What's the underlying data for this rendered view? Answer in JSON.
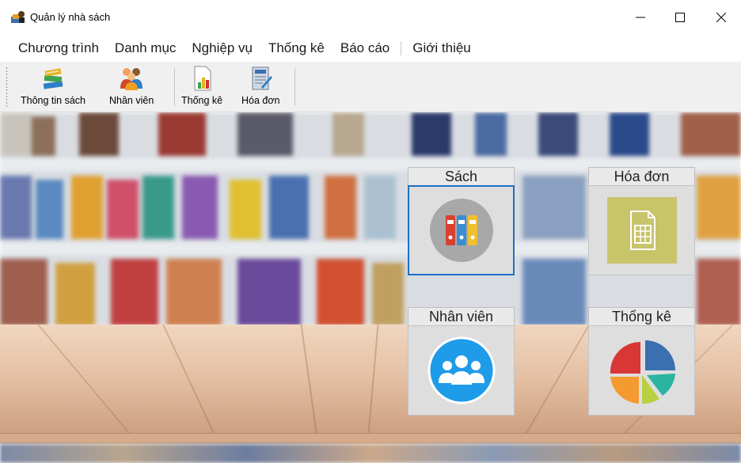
{
  "window": {
    "title": "Quản lý nhà sách",
    "app_icon": "bookstore-icon",
    "controls": [
      "minimize-icon",
      "maximize-icon",
      "close-icon"
    ]
  },
  "menu": {
    "items": [
      "Chương trình",
      "Danh mục",
      "Nghiệp vụ",
      "Thống kê",
      "Báo cáo",
      "Giới thiệu"
    ]
  },
  "toolbar": {
    "buttons": [
      {
        "label": "Thông tin sách",
        "icon": "books-icon"
      },
      {
        "label": "Nhân viên",
        "icon": "people-icon"
      },
      {
        "label": "Thống kê",
        "icon": "bar-chart-icon"
      },
      {
        "label": "Hóa đơn",
        "icon": "invoice-icon"
      }
    ]
  },
  "tiles": [
    {
      "label": "Sách",
      "icon": "binders-icon",
      "selected": true
    },
    {
      "label": "Hóa đơn",
      "icon": "spreadsheet-icon",
      "selected": false
    },
    {
      "label": "Nhân viên",
      "icon": "group-icon",
      "selected": false
    },
    {
      "label": "Thống kê",
      "icon": "pie-chart-icon",
      "selected": false
    }
  ],
  "colors": {
    "accent": "#1f6fc5",
    "tile_bg": "#dedede",
    "invoice_tile": "#c8c46a",
    "group_icon": "#1e9be9"
  }
}
